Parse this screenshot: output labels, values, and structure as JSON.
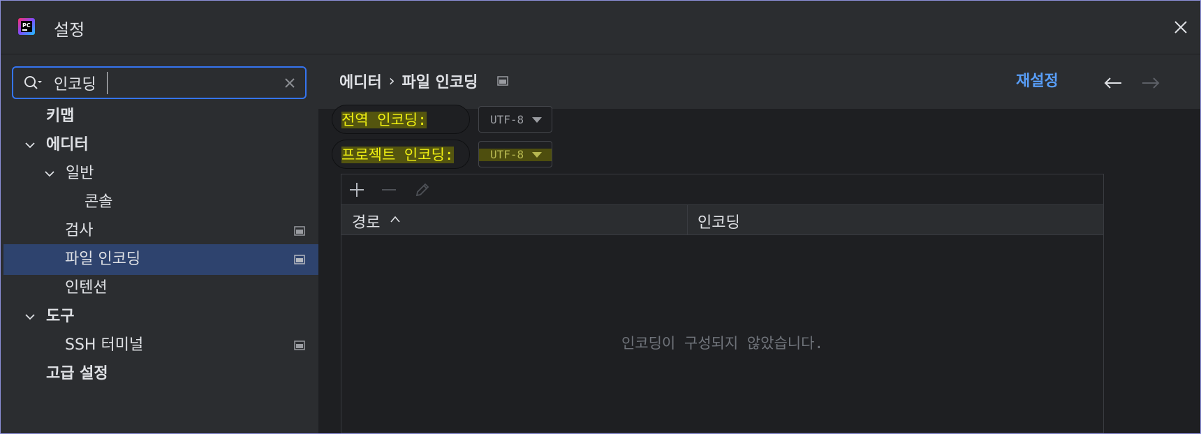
{
  "window": {
    "title": "설정"
  },
  "search": {
    "value": "인코딩"
  },
  "sidebar": {
    "items": [
      {
        "label": "키맵"
      },
      {
        "label": "에디터"
      },
      {
        "label": "일반"
      },
      {
        "label": "콘솔"
      },
      {
        "label": "검사"
      },
      {
        "label": "파일 인코딩"
      },
      {
        "label": "인텐션"
      },
      {
        "label": "도구"
      },
      {
        "label": "SSH 터미널"
      },
      {
        "label": "고급 설정"
      }
    ],
    "selected": "파일 인코딩"
  },
  "header": {
    "breadcrumb": [
      "에디터",
      "파일 인코딩"
    ],
    "separator": "›",
    "reset_label": "재설정"
  },
  "settings": {
    "global_label": "전역 인코딩:",
    "global_value": "UTF-8",
    "project_label": "프로젝트 인코딩:",
    "project_value": "UTF-8"
  },
  "table": {
    "columns": [
      "경로",
      "인코딩"
    ],
    "sort_column": "경로",
    "sort_direction": "ascending",
    "empty_message": "인코딩이 구성되지 않았습니다."
  },
  "colors": {
    "accent": "#3574f0",
    "link": "#589df6",
    "selection": "#2e436e",
    "highlight_text": "#f0f012"
  }
}
